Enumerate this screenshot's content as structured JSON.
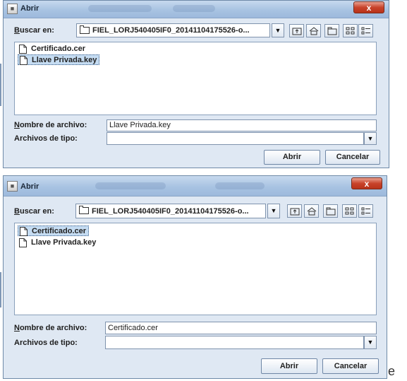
{
  "dialogs": [
    {
      "title": "Abrir",
      "close_label": "x",
      "look_in_label": "Buscar en:",
      "look_in_value": "FIEL_LORJ540405IF0_20141104175526-o...",
      "files": [
        {
          "name": "Certificado.cer",
          "selected": false
        },
        {
          "name": "Llave Privada.key",
          "selected": true
        }
      ],
      "filename_label": "Nombre de archivo:",
      "filename_value": "Llave Privada.key",
      "filetype_label": "Archivos de tipo:",
      "filetype_value": "",
      "open_button": "Abrir",
      "cancel_button": "Cancelar"
    },
    {
      "title": "Abrir",
      "close_label": "x",
      "look_in_label": "Buscar en:",
      "look_in_value": "FIEL_LORJ540405IF0_20141104175526-o...",
      "files": [
        {
          "name": "Certificado.cer",
          "selected": true
        },
        {
          "name": "Llave Privada.key",
          "selected": false
        }
      ],
      "filename_label": "Nombre de archivo:",
      "filename_value": "Certificado.cer",
      "filetype_label": "Archivos de tipo:",
      "filetype_value": "",
      "open_button": "Abrir",
      "cancel_button": "Cancelar"
    }
  ],
  "stray_text": "e",
  "icons": [
    "app-icon",
    "folder-icon",
    "chevron-down-icon",
    "up-folder-icon",
    "home-icon",
    "new-folder-icon",
    "list-view-icon",
    "details-view-icon",
    "document-icon"
  ],
  "colors": {
    "title_bar": "#a8c3e2",
    "close_button": "#c8432a",
    "selection": "#c5dcf2",
    "dialog_bg": "#dfe8f3"
  }
}
